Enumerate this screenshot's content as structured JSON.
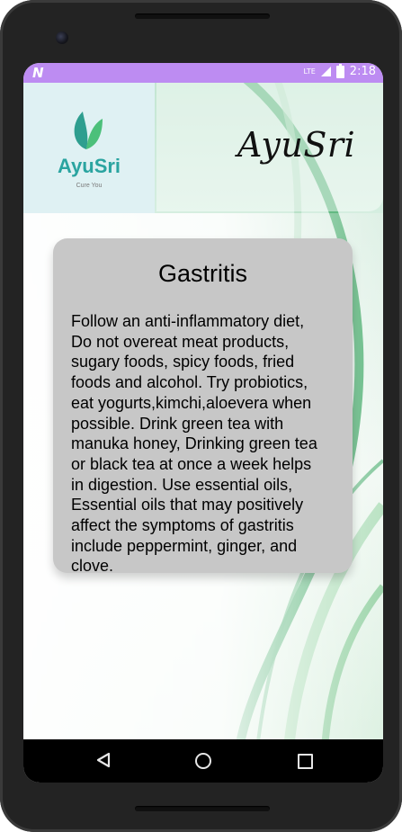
{
  "status_bar": {
    "notification_icon": "N",
    "network_label": "LTE",
    "time": "2:18"
  },
  "header": {
    "logo_title": "AyuSri",
    "logo_tagline": "Cure You",
    "brand_script": "AyuSri"
  },
  "card": {
    "title": "Gastritis",
    "body": "Follow an anti-inflammatory diet,\nDo not overeat meat products,\nsugary foods, spicy foods, fried\nfoods and alcohol. Try probiotics,\neat yogurts,kimchi,aloevera when\npossible.  Drink green tea with\nmanuka honey, Drinking green tea\nor black tea at once a week helps\nin digestion. Use essential oils,\nEssential oils that may positively\naffect the symptoms of gastritis\ninclude peppermint, ginger, and\nclove."
  },
  "colors": {
    "status_bar": "#bd8cf2",
    "card": "#c7c7c7",
    "logo_teal": "#2aa4a0",
    "accent_green": "#3fa96a"
  },
  "navigation": {
    "back": "back-icon",
    "home": "home-icon",
    "recents": "recents-icon"
  }
}
